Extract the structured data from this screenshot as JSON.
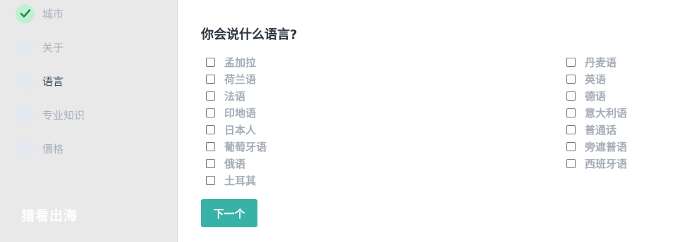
{
  "sidebar": {
    "steps": [
      {
        "label": "城市",
        "state": "done"
      },
      {
        "label": "关于",
        "state": "pending"
      },
      {
        "label": "语言",
        "state": "active"
      },
      {
        "label": "专业知识",
        "state": "pending"
      },
      {
        "label": "價格",
        "state": "pending"
      }
    ],
    "brand": "猎看出海"
  },
  "main": {
    "question": "你会说什么语言?",
    "languages_left": [
      "孟加拉",
      "荷兰语",
      "法语",
      "印地语",
      "日本人",
      "葡萄牙语",
      "俄语",
      "土耳其"
    ],
    "languages_right": [
      "丹麦语",
      "英语",
      "德语",
      "意大利语",
      "普通话",
      "旁遮普语",
      "西班牙语"
    ],
    "next_label": "下一个"
  },
  "colors": {
    "accent": "#38b2a6",
    "done_circle": "#bff0d1",
    "check": "#1e8a4c",
    "sidebar_bg": "#e9e9e9"
  }
}
